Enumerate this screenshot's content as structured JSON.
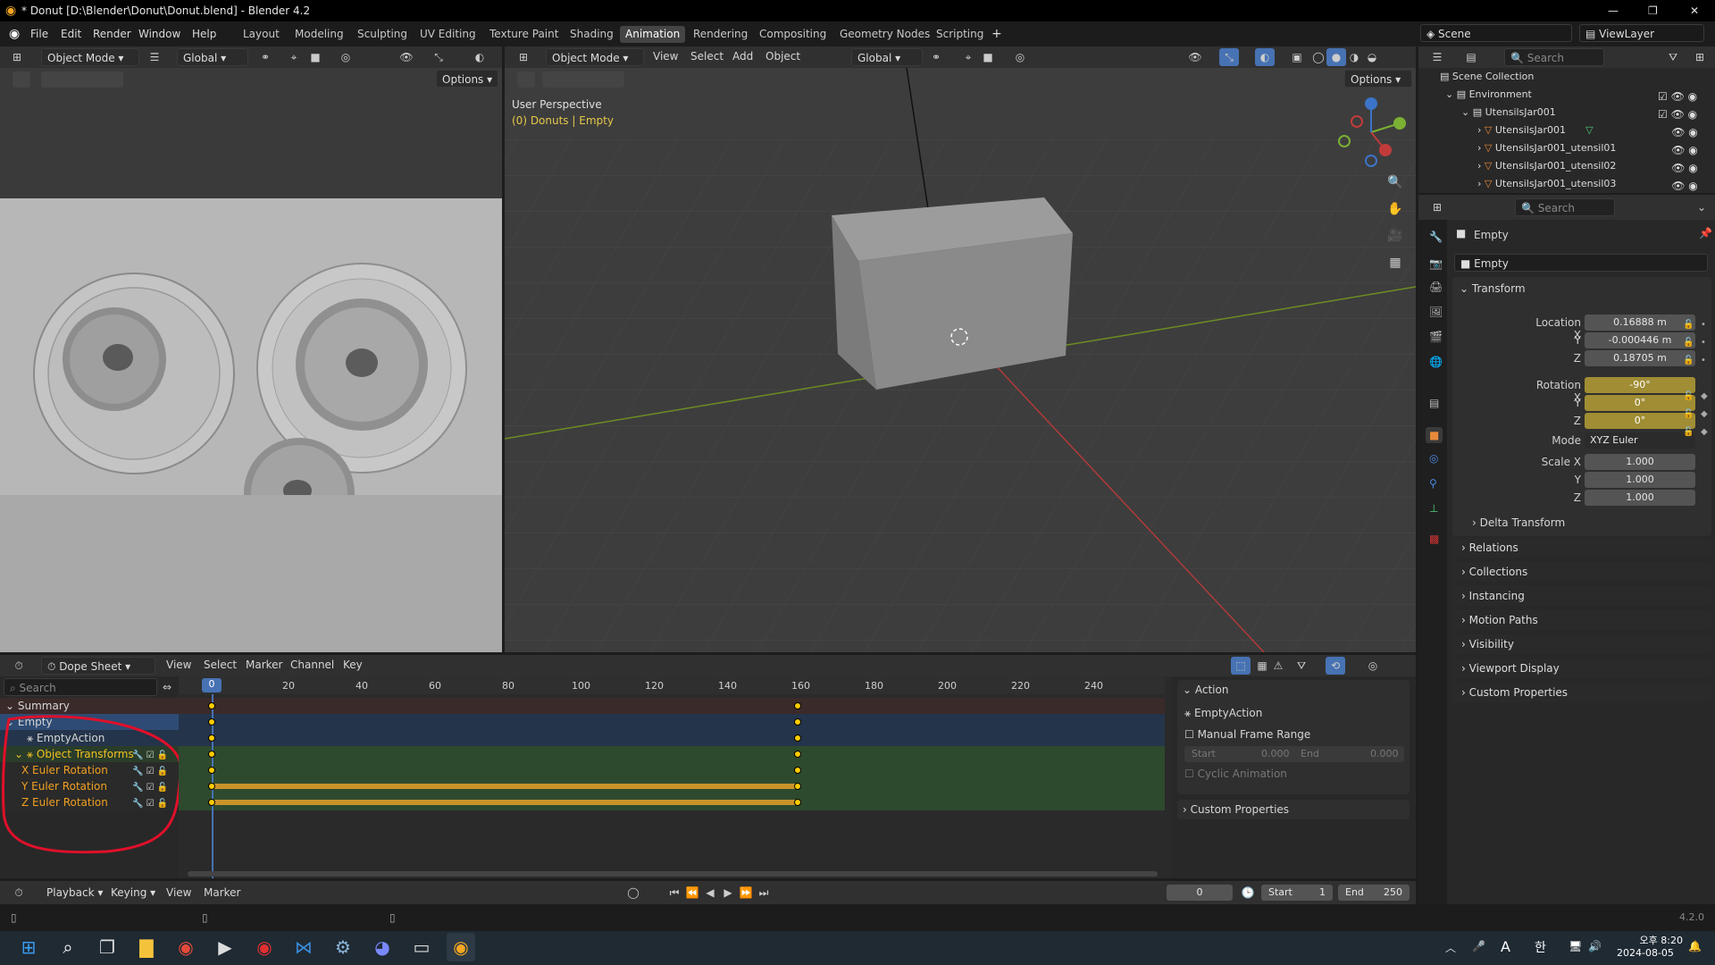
{
  "window": {
    "title": "* Donut [D:\\Blender\\Donut\\Donut.blend] - Blender 4.2"
  },
  "menu": [
    "File",
    "Edit",
    "Render",
    "Window",
    "Help"
  ],
  "workspaces": [
    "Layout",
    "Modeling",
    "Sculpting",
    "UV Editing",
    "Texture Paint",
    "Shading",
    "Animation",
    "Rendering",
    "Compositing",
    "Geometry Nodes",
    "Scripting"
  ],
  "active_workspace": "Animation",
  "scene": {
    "name": "Scene",
    "view_layer": "ViewLayer"
  },
  "left_view": {
    "mode": "Object Mode",
    "orientation": "Global",
    "options": "Options"
  },
  "main_view": {
    "mode": "Object Mode",
    "menus": [
      "View",
      "Select",
      "Add",
      "Object"
    ],
    "orientation": "Global",
    "options": "Options",
    "perspective": "User Perspective",
    "context": "(0) Donuts | Empty"
  },
  "outliner": {
    "search_placeholder": "Search",
    "items": [
      {
        "label": "Scene Collection"
      },
      {
        "label": "Environment"
      },
      {
        "label": "UtensilsJar001"
      },
      {
        "label": "UtensilsJar001"
      },
      {
        "label": "UtensilsJar001_utensil01"
      },
      {
        "label": "UtensilsJar001_utensil02"
      },
      {
        "label": "UtensilsJar001_utensil03"
      }
    ]
  },
  "properties": {
    "search_placeholder": "Search",
    "object_name": "Empty",
    "data_name": "Empty",
    "transform_title": "Transform",
    "location_label": "Location X",
    "loc_x": "0.16888 m",
    "loc_y": "-0.000446 m",
    "loc_z": "0.18705 m",
    "rotation_label": "Rotation X",
    "rot_x": "-90°",
    "rot_y": "0°",
    "rot_z": "0°",
    "mode_label": "Mode",
    "mode_value": "XYZ Euler",
    "scale_label": "Scale X",
    "scale_x": "1.000",
    "scale_y": "1.000",
    "scale_z": "1.000",
    "y_label": "Y",
    "z_label": "Z",
    "delta": "Delta Transform",
    "sections": [
      "Relations",
      "Collections",
      "Instancing",
      "Motion Paths",
      "Visibility",
      "Viewport Display",
      "Custom Properties"
    ]
  },
  "dopesheet": {
    "editor": "Dope Sheet",
    "menus": [
      "View",
      "Select",
      "Marker",
      "Channel",
      "Key"
    ],
    "search_placeholder": "Search",
    "current_frame": "0",
    "ticks": [
      "20",
      "40",
      "60",
      "80",
      "100",
      "120",
      "140",
      "160",
      "180",
      "200",
      "220",
      "240"
    ],
    "channels": [
      "Summary",
      "Empty",
      "EmptyAction",
      "Object Transforms",
      "X Euler Rotation",
      "Y Euler Rotation",
      "Z Euler Rotation"
    ],
    "keyframes": [
      0,
      160
    ]
  },
  "action_panel": {
    "title": "Action",
    "action_name": "EmptyAction",
    "manual_range": "Manual Frame Range",
    "start_label": "Start",
    "start_value": "0.000",
    "end_label": "End",
    "end_value": "0.000",
    "cyclic": "Cyclic Animation",
    "custom": "Custom Properties"
  },
  "timeline": {
    "menus": [
      "Playback",
      "Keying",
      "View",
      "Marker"
    ],
    "frame": "0",
    "start_label": "Start",
    "start": "1",
    "end_label": "End",
    "end": "250"
  },
  "version": "4.2.0",
  "taskbar": {
    "time": "오후 8:20",
    "date": "2024-08-05",
    "lang": "A",
    "ime": "한"
  },
  "colors": {
    "accent": "#4772b3",
    "keyframe": "#ffcc00",
    "rotation_field": "#a08d34",
    "annotation": "#e0102a"
  }
}
